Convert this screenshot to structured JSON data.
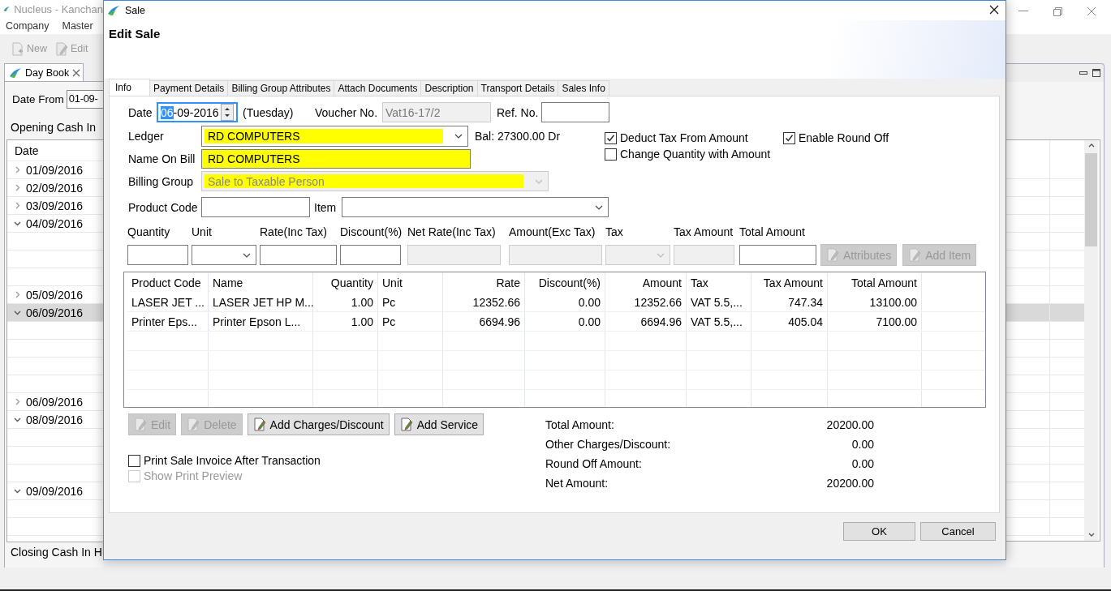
{
  "app": {
    "title": "Nucleus - Kanchan",
    "menu": [
      "Company",
      "Master"
    ],
    "toolbar": [
      {
        "label": "New",
        "kind": "new"
      },
      {
        "label": "Edit",
        "kind": "edit"
      }
    ]
  },
  "daybook": {
    "tab": "Day Book",
    "date_from_label": "Date From",
    "date_from_value": "01-09-",
    "opening_label": "Opening Cash In",
    "column": "Date",
    "rows": [
      {
        "date": "01/09/2016",
        "expanded": false,
        "selected": false
      },
      {
        "date": "02/09/2016",
        "expanded": false,
        "selected": false
      },
      {
        "date": "03/09/2016",
        "expanded": false,
        "selected": false
      },
      {
        "date": "04/09/2016",
        "expanded": true,
        "selected": false,
        "children": [
          {
            "selected": false
          },
          {
            "selected": false
          },
          {
            "selected": false
          }
        ]
      },
      {
        "date": "05/09/2016",
        "expanded": false,
        "selected": false
      },
      {
        "date": "06/09/2016",
        "expanded": true,
        "selected": true,
        "children": [
          {
            "selected": false
          },
          {
            "selected": false
          },
          {
            "selected": false
          },
          {
            "selected": false
          }
        ]
      },
      {
        "date": "06/09/2016",
        "expanded": false,
        "selected": false
      },
      {
        "date": "08/09/2016",
        "expanded": true,
        "selected": false,
        "children": [
          {
            "selected": false
          },
          {
            "selected": false
          },
          {
            "selected": false
          }
        ]
      },
      {
        "date": "09/09/2016",
        "expanded": true,
        "selected": false,
        "children": [
          {
            "selected": false
          },
          {
            "selected": false
          }
        ]
      }
    ],
    "closing_label": "Closing Cash In H"
  },
  "dialog": {
    "title": "Sale",
    "heading": "Edit Sale",
    "tabs": [
      {
        "label": "Info",
        "selected": true
      },
      {
        "label": "Payment Details",
        "selected": false
      },
      {
        "label": "Billing Group Attributes",
        "selected": false
      },
      {
        "label": "Attach Documents",
        "selected": false
      },
      {
        "label": "Description",
        "selected": false
      },
      {
        "label": "Transport Details",
        "selected": false
      },
      {
        "label": "Sales Info",
        "selected": false
      }
    ],
    "date": {
      "label": "Date",
      "value": "06-09-2016",
      "focused": true,
      "weekday": "(Tuesday)"
    },
    "voucher": {
      "label": "Voucher No.",
      "value": "Vat16-17/2",
      "disabled": true
    },
    "ref": {
      "label": "Ref. No."
    },
    "fields": [
      {
        "label": "Ledger",
        "kind": "combo",
        "value": "RD COMPUTERS",
        "highlight": true,
        "disabled": false
      },
      {
        "label": "Name On Bill",
        "kind": "text",
        "value": "RD COMPUTERS",
        "highlight": true,
        "disabled": false
      },
      {
        "label": "Billing Group",
        "kind": "combo",
        "value": "Sale to Taxable Person",
        "highlight": true,
        "disabled": true
      }
    ],
    "balance": "Bal: 27300.00 Dr",
    "options": [
      {
        "label": "Deduct Tax From Amount",
        "checked": true
      },
      {
        "label": "Enable Round Off",
        "checked": true
      },
      {
        "label": "Change Quantity with Amount",
        "checked": false
      }
    ],
    "product_code": {
      "label": "Product Code"
    },
    "item": {
      "label": "Item"
    },
    "entry": [
      {
        "label": "Quantity",
        "kind": "text",
        "disabled": false
      },
      {
        "label": "Unit",
        "kind": "combo",
        "disabled": false
      },
      {
        "label": "Rate(Inc Tax)",
        "kind": "text",
        "disabled": false
      },
      {
        "label": "Discount(%)",
        "kind": "text",
        "disabled": false
      },
      {
        "label": "Net Rate(Inc Tax)",
        "kind": "text",
        "disabled": true
      },
      {
        "label": "Amount(Exc Tax)",
        "kind": "text",
        "disabled": true
      },
      {
        "label": "Tax",
        "kind": "combo",
        "disabled": true
      },
      {
        "label": "Tax Amount",
        "kind": "text",
        "disabled": true
      },
      {
        "label": "Total Amount",
        "kind": "text",
        "disabled": false
      }
    ],
    "entry_buttons": [
      {
        "label": "Attributes",
        "disabled": true
      },
      {
        "label": "Add Item",
        "disabled": true
      }
    ],
    "items_table": {
      "columns": [
        {
          "label": "Product Code",
          "kind": "text"
        },
        {
          "label": "Name",
          "kind": "text"
        },
        {
          "label": "Quantity",
          "kind": "number"
        },
        {
          "label": "Unit",
          "kind": "text"
        },
        {
          "label": "Rate",
          "kind": "number"
        },
        {
          "label": "Discount(%)",
          "kind": "number"
        },
        {
          "label": "Amount",
          "kind": "number"
        },
        {
          "label": "Tax",
          "kind": "text"
        },
        {
          "label": "Tax Amount",
          "kind": "number"
        },
        {
          "label": "Total Amount",
          "kind": "number"
        }
      ],
      "rows": [
        [
          "LASER JET ...",
          "LASER JET HP M...",
          "1.00",
          "Pc",
          "12352.66",
          "0.00",
          "12352.66",
          "VAT 5.5,...",
          "747.34",
          "13100.00"
        ],
        [
          "Printer Eps...",
          "Printer Epson L...",
          "1.00",
          "Pc",
          "6694.96",
          "0.00",
          "6694.96",
          "VAT 5.5,...",
          "405.04",
          "7100.00"
        ]
      ]
    },
    "actions": [
      {
        "label": "Edit",
        "disabled": true
      },
      {
        "label": "Delete",
        "disabled": true
      },
      {
        "label": "Add Charges/Discount",
        "disabled": false
      },
      {
        "label": "Add Service",
        "disabled": false
      }
    ],
    "print_options": [
      {
        "label": "Print Sale Invoice After Transaction",
        "checked": false,
        "disabled": false
      },
      {
        "label": "Show Print Preview",
        "checked": false,
        "disabled": true
      }
    ],
    "totals": [
      {
        "label": "Total Amount:",
        "value": "20200.00"
      },
      {
        "label": "Other Charges/Discount:",
        "value": "0.00"
      },
      {
        "label": "Round Off Amount:",
        "value": "0.00"
      },
      {
        "label": "Net Amount:",
        "value": "20200.00"
      }
    ],
    "footer": [
      "OK",
      "Cancel"
    ]
  }
}
